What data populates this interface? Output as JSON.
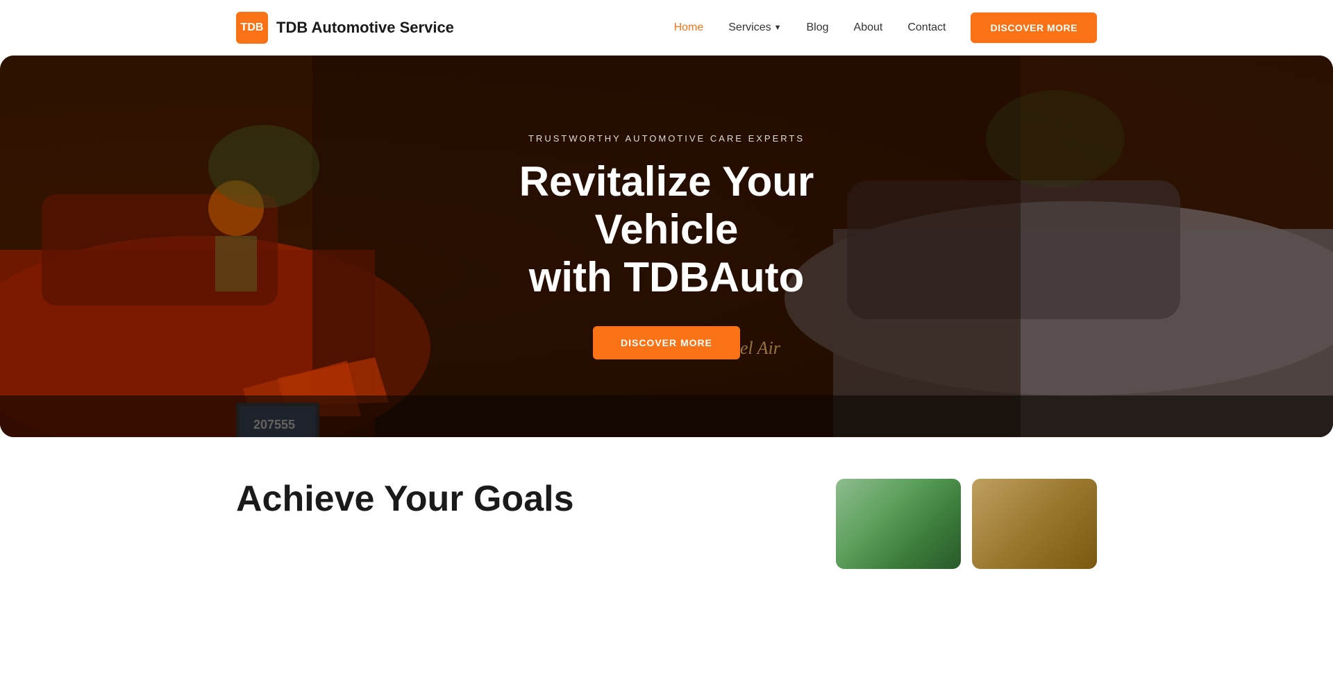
{
  "brand": {
    "logo_text": "TDB",
    "name": "TDB Automotive Service"
  },
  "nav": {
    "home": "Home",
    "services": "Services",
    "blog": "Blog",
    "about": "About",
    "contact": "Contact",
    "discover_btn": "DISCOVER MORE"
  },
  "hero": {
    "tagline": "TRUSTWORTHY AUTOMOTIVE CARE EXPERTS",
    "title_line1": "Revitalize Your Vehicle",
    "title_line2": "with TDBAuto",
    "cta": "DISCOVER MORE"
  },
  "below": {
    "title": "Achieve Your Goals"
  }
}
